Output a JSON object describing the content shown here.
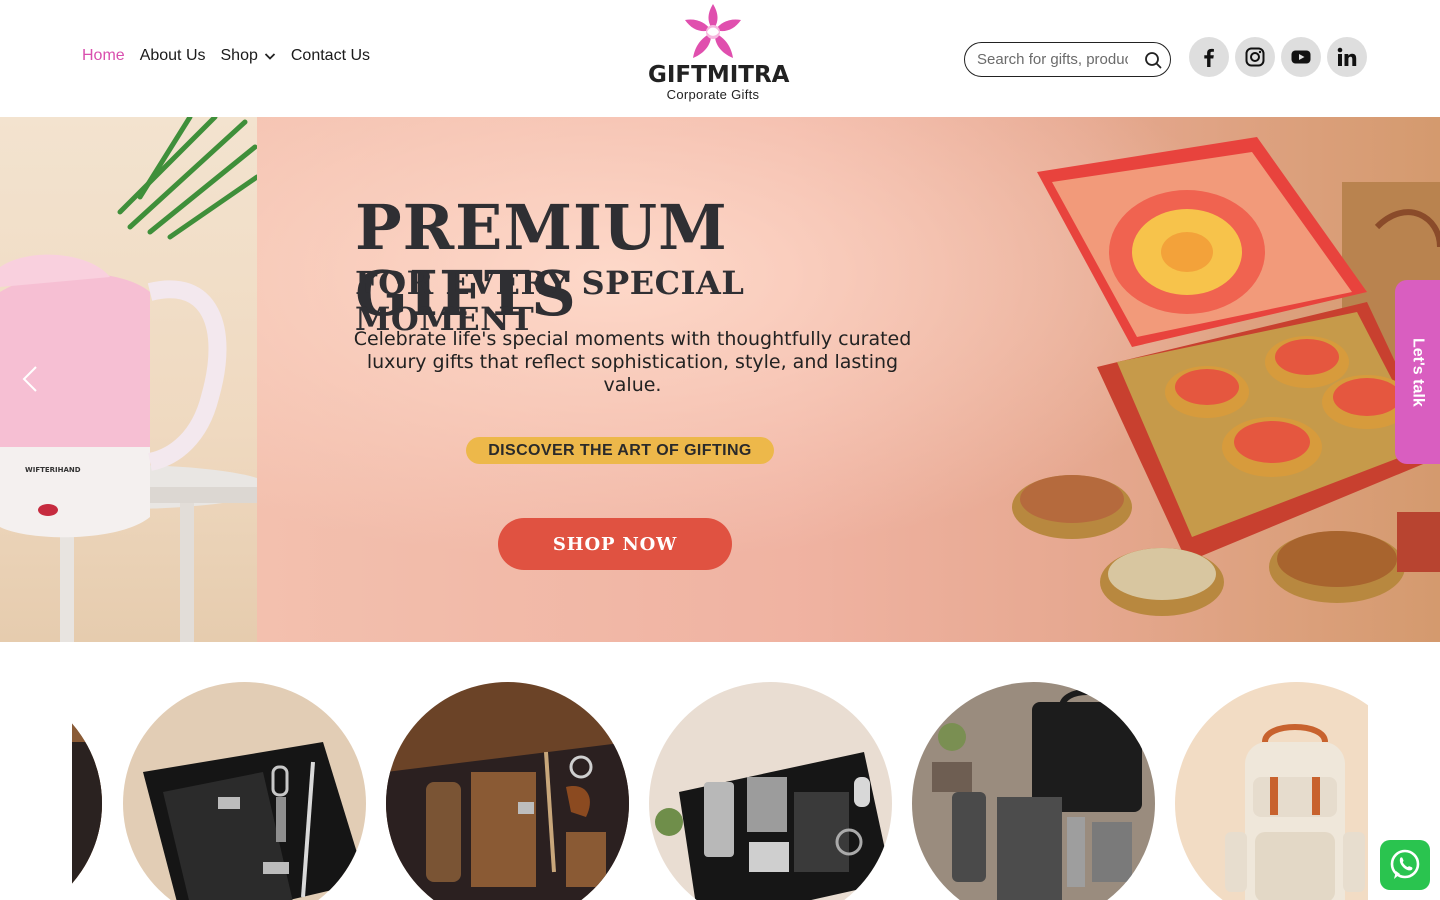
{
  "nav": {
    "items": [
      {
        "label": "Home",
        "active": true
      },
      {
        "label": "About Us",
        "active": false
      },
      {
        "label": "Shop",
        "active": false,
        "has_dropdown": true
      },
      {
        "label": "Contact Us",
        "active": false
      }
    ]
  },
  "logo": {
    "brand": "GIFTMITRA",
    "tagline": "Corporate Gifts",
    "icon": "flower-logo-icon"
  },
  "search": {
    "placeholder": "Search for gifts, products",
    "icon": "search-icon"
  },
  "socials": [
    {
      "name": "facebook-icon"
    },
    {
      "name": "instagram-icon"
    },
    {
      "name": "youtube-icon"
    },
    {
      "name": "linkedin-icon"
    }
  ],
  "hero": {
    "title": "PREMIUM GIFTS",
    "subtitle": "FOR EVERY SPECIAL MOMENT",
    "description": "Celebrate life's special moments with thoughtfully curated luxury gifts that reflect sophistication, style, and lasting value.",
    "tagline": "DISCOVER THE ART OF GIFTING",
    "cta": "SHOP NOW"
  },
  "side_tab": {
    "label": "Let's talk"
  },
  "categories": [
    {
      "name": "category-partial"
    },
    {
      "name": "black-diary-gift-set"
    },
    {
      "name": "brown-leather-gift-set"
    },
    {
      "name": "steel-tumbler-gift-set"
    },
    {
      "name": "grey-executive-gift-set"
    },
    {
      "name": "backpack"
    }
  ],
  "colors": {
    "accent_pink": "#d94fae",
    "tag_yellow": "#edb84a",
    "cta_red": "#e05241",
    "talk_pink": "#d95ec0",
    "whatsapp_green": "#2ac44f"
  }
}
